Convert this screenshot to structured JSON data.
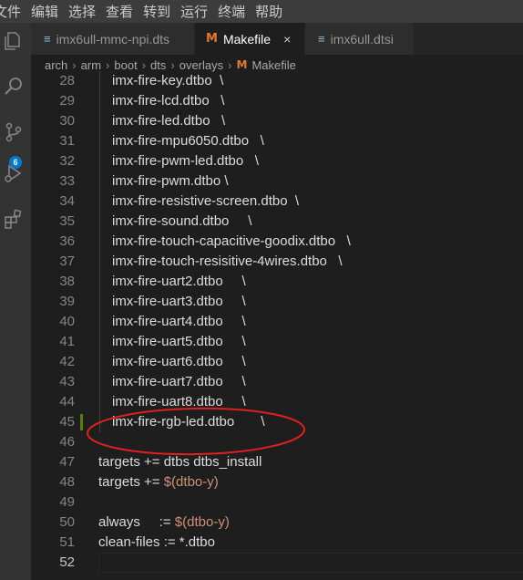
{
  "menubar": [
    "文件",
    "编辑",
    "选择",
    "查看",
    "转到",
    "运行",
    "终端",
    "帮助"
  ],
  "activity": {
    "source_control_badge": "6",
    "icons": [
      "explorer-icon",
      "search-icon",
      "source-control-icon",
      "run-debug-icon",
      "extensions-icon"
    ]
  },
  "tabs": [
    {
      "label": "imx6ull-mmc-npi.dts",
      "icon": "lines-icon",
      "active": false
    },
    {
      "label": "Makefile",
      "icon": "M",
      "active": true,
      "close": "×"
    },
    {
      "label": "imx6ull.dtsi",
      "icon": "lines-icon",
      "active": false
    }
  ],
  "breadcrumb": [
    "arch",
    "arm",
    "boot",
    "dts",
    "overlays",
    "Makefile"
  ],
  "breadcrumb_sep": "›",
  "file_icon_letter": "M",
  "lines": [
    {
      "n": "28",
      "text": "imx-fire-key.dtbo  \\"
    },
    {
      "n": "29",
      "text": "imx-fire-lcd.dtbo   \\"
    },
    {
      "n": "30",
      "text": "imx-fire-led.dtbo   \\"
    },
    {
      "n": "31",
      "text": "imx-fire-mpu6050.dtbo   \\"
    },
    {
      "n": "32",
      "text": "imx-fire-pwm-led.dtbo   \\"
    },
    {
      "n": "33",
      "text": "imx-fire-pwm.dtbo \\"
    },
    {
      "n": "34",
      "text": "imx-fire-resistive-screen.dtbo  \\"
    },
    {
      "n": "35",
      "text": "imx-fire-sound.dtbo     \\"
    },
    {
      "n": "36",
      "text": "imx-fire-touch-capacitive-goodix.dtbo   \\"
    },
    {
      "n": "37",
      "text": "imx-fire-touch-resisitive-4wires.dtbo   \\"
    },
    {
      "n": "38",
      "text": "imx-fire-uart2.dtbo     \\"
    },
    {
      "n": "39",
      "text": "imx-fire-uart3.dtbo     \\"
    },
    {
      "n": "40",
      "text": "imx-fire-uart4.dtbo     \\"
    },
    {
      "n": "41",
      "text": "imx-fire-uart5.dtbo     \\"
    },
    {
      "n": "42",
      "text": "imx-fire-uart6.dtbo     \\"
    },
    {
      "n": "43",
      "text": "imx-fire-uart7.dtbo     \\"
    },
    {
      "n": "44",
      "text": "imx-fire-uart8.dtbo     \\"
    },
    {
      "n": "45",
      "text": "imx-fire-rgb-led.dtbo       \\"
    },
    {
      "n": "46",
      "text": ""
    },
    {
      "n": "47",
      "text": "targets += dtbs dtbs_install"
    },
    {
      "n": "48",
      "text": "targets += ",
      "var": "$(dtbo-y)"
    },
    {
      "n": "49",
      "text": ""
    },
    {
      "n": "50",
      "text": "always     := ",
      "var": "$(dtbo-y)"
    },
    {
      "n": "51",
      "text": "clean-files := *.dtbo"
    },
    {
      "n": "52",
      "text": ""
    }
  ],
  "colors": {
    "annotation": "#e02020",
    "makefile_icon": "#e37933",
    "variable": "#ce9178",
    "badge": "#007acc",
    "modified_gutter": "#587c0c"
  }
}
